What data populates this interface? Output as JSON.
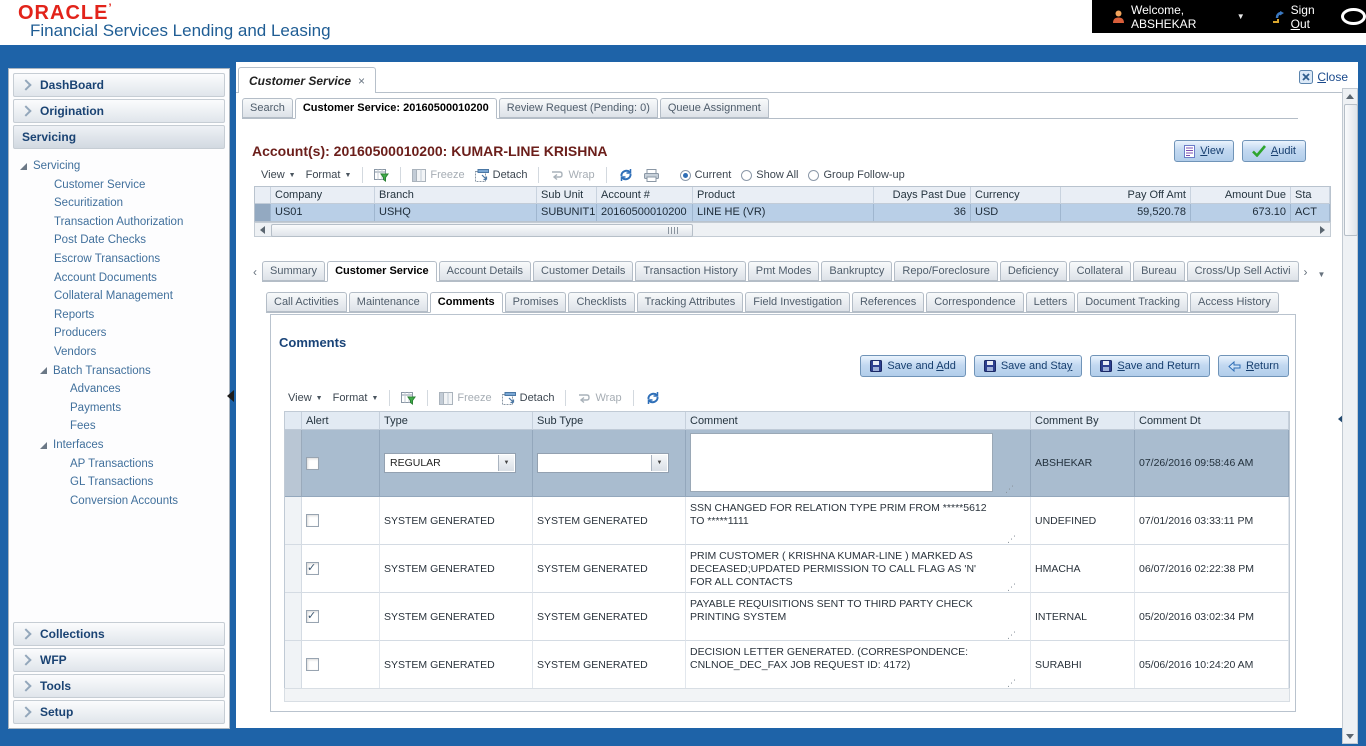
{
  "brand": {
    "logo": "ORACLE",
    "mark": "’",
    "subtitle": "Financial Services Lending and Leasing"
  },
  "topbar": {
    "welcome": "Welcome, ABSHEKAR",
    "signout_pre": "Sign ",
    "signout_key": "O",
    "signout_post": "ut"
  },
  "workspace": {
    "tab_label": "Customer Service",
    "close_key": "C",
    "close_post": "lose",
    "subtabs": [
      "Search",
      "Customer Service: 20160500010200",
      "Review Request (Pending: 0)",
      "Queue Assignment"
    ]
  },
  "sidebar": {
    "sections_top": [
      {
        "label": "DashBoard"
      },
      {
        "label": "Origination"
      },
      {
        "label": "Servicing"
      }
    ],
    "sections_bottom": [
      {
        "label": "Collections"
      },
      {
        "label": "WFP"
      },
      {
        "label": "Tools"
      },
      {
        "label": "Setup"
      }
    ],
    "tree": [
      {
        "label": "Servicing"
      },
      {
        "label": "Customer Service"
      },
      {
        "label": "Securitization"
      },
      {
        "label": "Transaction Authorization"
      },
      {
        "label": "Post Date Checks"
      },
      {
        "label": "Escrow Transactions"
      },
      {
        "label": "Account Documents"
      },
      {
        "label": "Collateral Management"
      },
      {
        "label": "Reports"
      },
      {
        "label": "Producers"
      },
      {
        "label": "Vendors"
      },
      {
        "label": "Batch Transactions"
      },
      {
        "label": "Advances"
      },
      {
        "label": "Payments"
      },
      {
        "label": "Fees"
      },
      {
        "label": "Interfaces"
      },
      {
        "label": "AP Transactions"
      },
      {
        "label": "GL Transactions"
      },
      {
        "label": "Conversion Accounts"
      }
    ]
  },
  "toolbar": {
    "view": "View",
    "format": "Format",
    "freeze": "Freeze",
    "detach": "Detach",
    "wrap": "Wrap"
  },
  "account": {
    "title": "Account(s): 20160500010200: KUMAR-LINE KRISHNA",
    "view_key": "V",
    "view_post": "iew",
    "audit_key": "A",
    "audit_post": "udit",
    "radios": [
      "Current",
      "Show All",
      "Group Follow-up"
    ],
    "radio_selected": "Current",
    "columns": [
      "Company",
      "Branch",
      "Sub Unit",
      "Account #",
      "Product",
      "Days Past Due",
      "Currency",
      "Pay Off Amt",
      "Amount Due",
      "Sta"
    ],
    "row": {
      "company": "US01",
      "branch": "USHQ",
      "sub_unit": "SUBUNIT1",
      "account": "20160500010200",
      "product": "LINE HE (VR)",
      "days_past_due": "36",
      "currency": "USD",
      "pay_off_amt": "59,520.78",
      "amount_due": "673.10",
      "status": "ACT"
    }
  },
  "tabs_level2": [
    "Summary",
    "Customer Service",
    "Account Details",
    "Customer Details",
    "Transaction History",
    "Pmt Modes",
    "Bankruptcy",
    "Repo/Foreclosure",
    "Deficiency",
    "Collateral",
    "Bureau",
    "Cross/Up Sell Activi"
  ],
  "tabs_level2_active": "Customer Service",
  "tabs_level3": [
    "Call Activities",
    "Maintenance",
    "Comments",
    "Promises",
    "Checklists",
    "Tracking Attributes",
    "Field Investigation",
    "References",
    "Correspondence",
    "Letters",
    "Document Tracking",
    "Access History"
  ],
  "tabs_level3_active": "Comments",
  "comments": {
    "title": "Comments",
    "btn_save_add_pre": "Save and ",
    "btn_save_add_key": "A",
    "btn_save_add_post": "dd",
    "btn_save_stay_pre": "Save and Sta",
    "btn_save_stay_key": "y",
    "btn_save_stay_post": "",
    "btn_save_return_key": "S",
    "btn_save_return_post": "ave and Return",
    "btn_return_key": "R",
    "btn_return_post": "eturn",
    "columns": [
      "Alert",
      "Type",
      "Sub Type",
      "Comment",
      "Comment By",
      "Comment Dt"
    ],
    "edit_row": {
      "alert": false,
      "type": "REGULAR",
      "sub_type": "",
      "comment": "",
      "by": "ABSHEKAR",
      "dt": "07/26/2016 09:58:46 AM"
    },
    "rows": [
      {
        "alert": false,
        "type": "SYSTEM GENERATED",
        "sub_type": "SYSTEM GENERATED",
        "comment": "SSN CHANGED FOR RELATION TYPE PRIM FROM *****5612 TO *****1111",
        "by": "UNDEFINED",
        "dt": "07/01/2016 03:33:11 PM"
      },
      {
        "alert": true,
        "type": "SYSTEM GENERATED",
        "sub_type": "SYSTEM GENERATED",
        "comment": "PRIM CUSTOMER ( KRISHNA KUMAR-LINE ) MARKED AS DECEASED;UPDATED PERMISSION TO CALL FLAG AS 'N' FOR ALL CONTACTS",
        "by": "HMACHA",
        "dt": "06/07/2016 02:22:38 PM"
      },
      {
        "alert": true,
        "type": "SYSTEM GENERATED",
        "sub_type": "SYSTEM GENERATED",
        "comment": "PAYABLE REQUISITIONS SENT TO THIRD PARTY CHECK PRINTING SYSTEM",
        "by": "INTERNAL",
        "dt": "05/20/2016 03:02:34 PM"
      },
      {
        "alert": false,
        "type": "SYSTEM GENERATED",
        "sub_type": "SYSTEM GENERATED",
        "comment": "DECISION LETTER GENERATED. (CORRESPONDENCE: CNLNOE_DEC_FAX JOB REQUEST ID: 4172)",
        "by": "SURABHI",
        "dt": "05/06/2016 10:24:20 AM"
      }
    ]
  },
  "colors": {
    "frame_blue": "#1e63a8",
    "oracle_red": "#e2231a",
    "accent_navy": "#173f6f",
    "account_title_maroon": "#6b1e1a",
    "selected_row": "#b9cfe7",
    "edit_row": "#a9bccf"
  }
}
